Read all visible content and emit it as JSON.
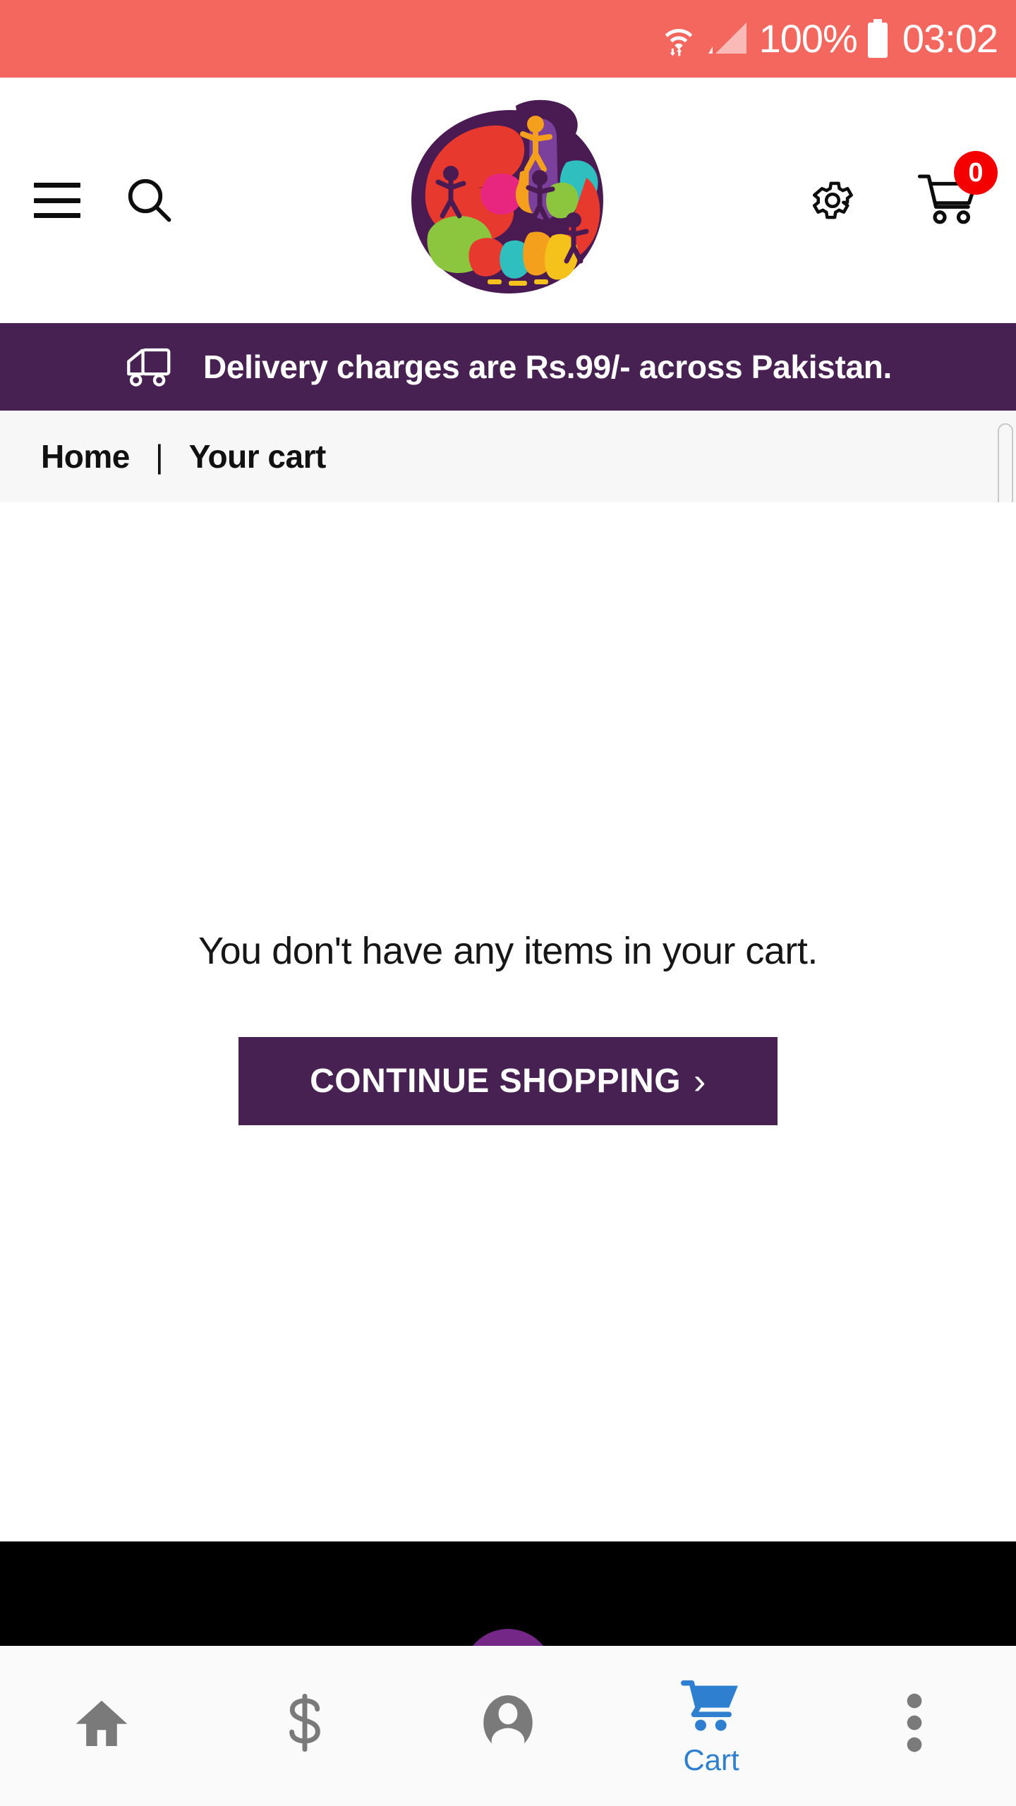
{
  "status_bar": {
    "wifi_icon": "wifi-icon",
    "signal_icon": "cellular-signal-icon",
    "battery_percent": "100%",
    "battery_icon": "battery-full-icon",
    "time": "03:02",
    "background_color": "#f4675f"
  },
  "header": {
    "menu_icon": "hamburger-menu-icon",
    "search_icon": "search-icon",
    "logo_alt": "Bachaa Party",
    "settings_icon": "gear-icon",
    "cart_icon": "shopping-cart-icon",
    "cart_badge_count": "0",
    "cart_badge_color": "#f40000"
  },
  "delivery_banner": {
    "icon": "delivery-truck-icon",
    "text": "Delivery charges are Rs.99/- across Pakistan.",
    "background_color": "#472152"
  },
  "breadcrumb": {
    "items": [
      {
        "label": "Home"
      },
      {
        "label": "Your cart"
      }
    ],
    "separator": "|"
  },
  "cart": {
    "empty_message": "You don't have any items in your cart.",
    "continue_button_label": "CONTINUE SHOPPING",
    "continue_button_chevron": "›",
    "continue_button_color": "#472152"
  },
  "bottom_nav": {
    "active_color": "#2f7fd1",
    "inactive_color": "#7a7a7a",
    "items": [
      {
        "icon": "home-icon",
        "label": "",
        "active": false
      },
      {
        "icon": "dollar-sign-icon",
        "label": "",
        "active": false
      },
      {
        "icon": "account-person-icon",
        "label": "",
        "active": false
      },
      {
        "icon": "shopping-cart-icon",
        "label": "Cart",
        "active": true
      },
      {
        "icon": "more-vertical-icon",
        "label": "",
        "active": false
      }
    ]
  }
}
